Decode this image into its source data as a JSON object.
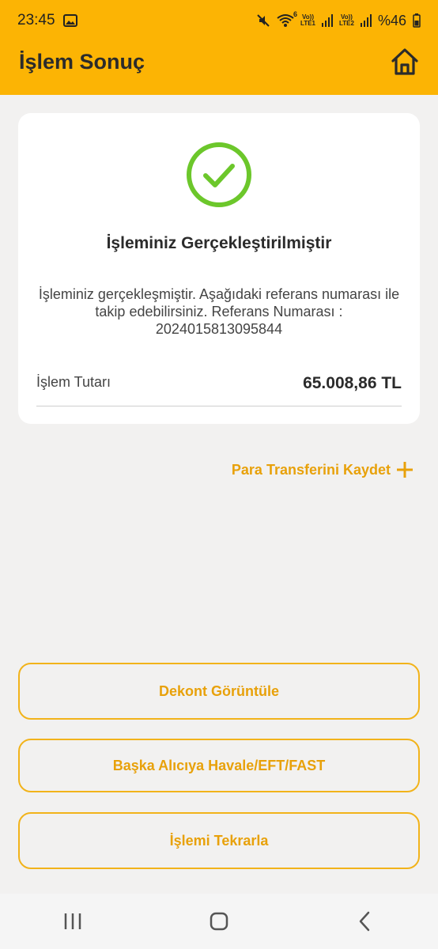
{
  "status_bar": {
    "time": "23:45",
    "battery_text": "%46",
    "sim1_label_top": "Vo))",
    "sim1_label_bottom": "LTE1",
    "sim2_label_top": "Vo))",
    "sim2_label_bottom": "LTE2",
    "wifi_badge": "6",
    "icons": [
      "image-icon",
      "mute-icon",
      "wifi-icon",
      "signal-icon",
      "battery-icon"
    ]
  },
  "header": {
    "title": "İşlem Sonuç",
    "home_icon": "home-icon",
    "color": "#fcb404"
  },
  "result_card": {
    "icon": "check-circle-icon",
    "icon_color": "#6cc72b",
    "title": "İşleminiz Gerçekleştirilmiştir",
    "description": "İşleminiz gerçekleşmiştir. Aşağıdaki referans numarası ile takip edebilirsiniz. Referans Numarası : 2024015813095844",
    "amount_label": "İşlem Tutarı",
    "amount_value": "65.008,86 TL"
  },
  "save_transfer": {
    "label": "Para Transferini Kaydet",
    "icon": "plus-icon"
  },
  "actions": {
    "view_receipt": "Dekont Görüntüle",
    "other_recipient": "Başka Alıcıya Havale/EFT/FAST",
    "repeat": "İşlemi Tekrarla"
  },
  "accent_color": "#e8a10a",
  "nav_bar": {
    "icons": [
      "recent-apps-icon",
      "home-nav-icon",
      "back-icon"
    ]
  }
}
